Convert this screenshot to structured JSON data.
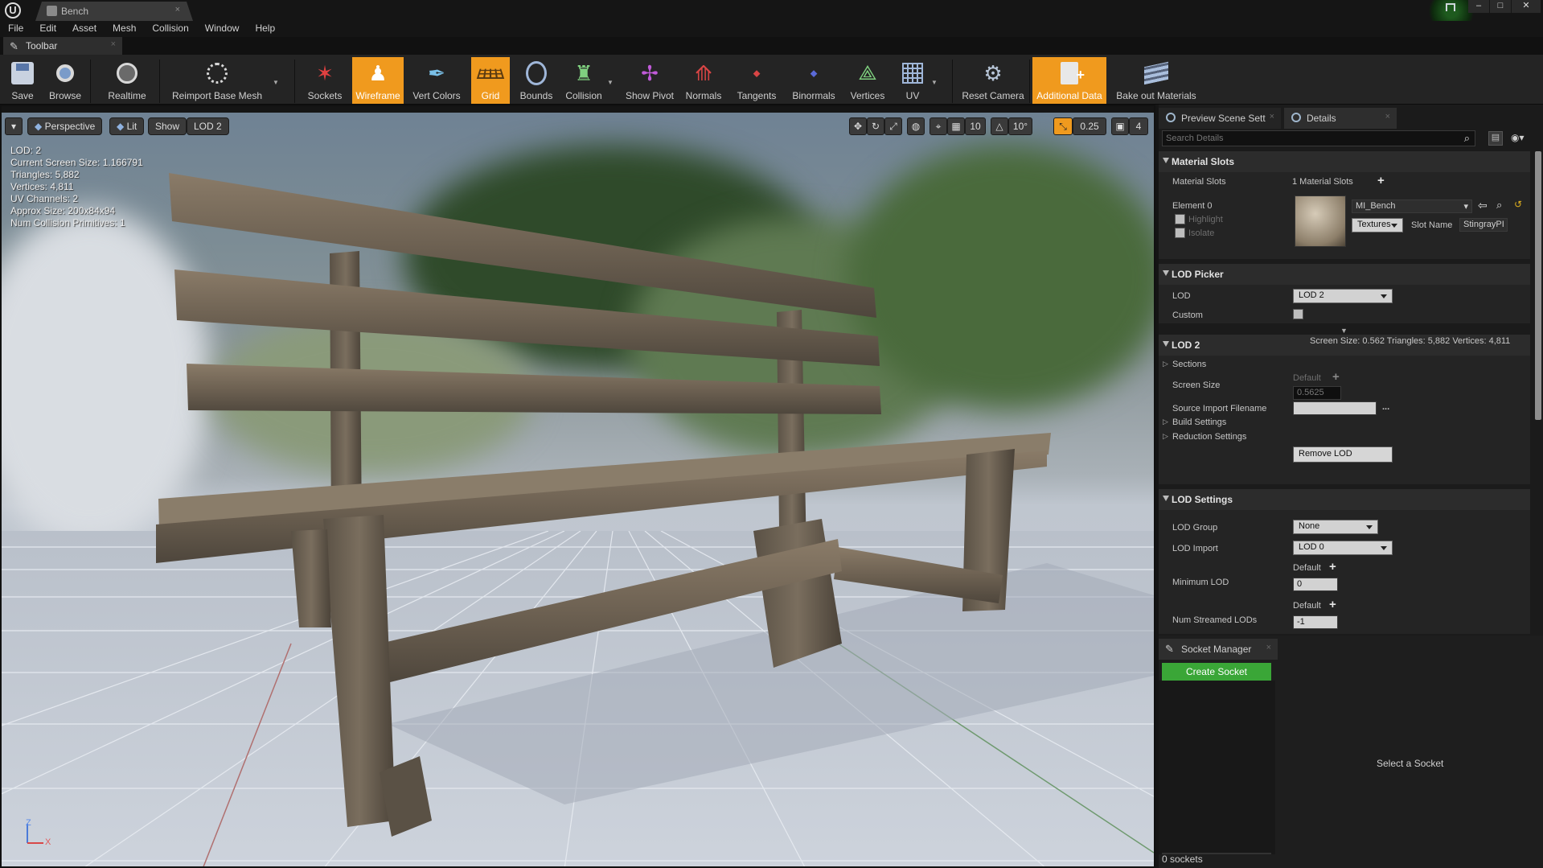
{
  "window": {
    "logo": "U",
    "tab_title": "Bench",
    "tab_close": "×",
    "minimize": "–",
    "maximize": "□",
    "close": "✕"
  },
  "menu": [
    "File",
    "Edit",
    "Asset",
    "Mesh",
    "Collision",
    "Window",
    "Help"
  ],
  "toolbar_tab": {
    "label": "Toolbar",
    "close": "×"
  },
  "toolbar": [
    {
      "label": "Save",
      "icon": "save-icon"
    },
    {
      "label": "Browse",
      "icon": "browse-icon"
    },
    {
      "label": "Realtime",
      "icon": "realtime-icon"
    },
    {
      "label": "Reimport Base Mesh",
      "icon": "reimport-icon"
    },
    {
      "label": "Sockets",
      "icon": "sockets-icon"
    },
    {
      "label": "Wireframe",
      "icon": "wireframe-icon",
      "active": true
    },
    {
      "label": "Vert Colors",
      "icon": "vert-colors-icon"
    },
    {
      "label": "Grid",
      "icon": "grid-icon",
      "active": true
    },
    {
      "label": "Bounds",
      "icon": "bounds-icon"
    },
    {
      "label": "Collision",
      "icon": "collision-icon"
    },
    {
      "label": "Show Pivot",
      "icon": "pivot-icon"
    },
    {
      "label": "Normals",
      "icon": "normals-icon"
    },
    {
      "label": "Tangents",
      "icon": "tangents-icon"
    },
    {
      "label": "Binormals",
      "icon": "binormals-icon"
    },
    {
      "label": "Vertices",
      "icon": "vertices-icon"
    },
    {
      "label": "UV",
      "icon": "uv-icon"
    },
    {
      "label": "Reset Camera",
      "icon": "camera-icon"
    },
    {
      "label": "Additional Data",
      "icon": "additional-data-icon",
      "active": true
    },
    {
      "label": "Bake out Materials",
      "icon": "bake-materials-icon"
    }
  ],
  "viewport": {
    "buttons": {
      "perspective": "Perspective",
      "lit": "Lit",
      "show": "Show",
      "lod": "LOD 2"
    },
    "grid_snap": "10",
    "rotation_snap": "10°",
    "scale_snap": "0.25",
    "camera_speed": "4",
    "stats": [
      "LOD: 2",
      "Current Screen Size: 1.166791",
      "Triangles: 5,882",
      "Vertices: 4,811",
      "UV Channels: 2",
      "Approx Size: 200x84x94",
      "Num Collision Primitives: 1"
    ],
    "axis": {
      "z": "Z",
      "x": "X"
    },
    "colors": {
      "active_orange": "#f09a1e"
    }
  },
  "panel_tabs": [
    {
      "label": "Preview Scene Sett",
      "close": "×"
    },
    {
      "label": "Details",
      "close": "×"
    }
  ],
  "search": {
    "placeholder": "Search Details"
  },
  "material_slots": {
    "header": "Material Slots",
    "label": "Material Slots",
    "count": "1 Material Slots",
    "element_label": "Element 0",
    "highlight": "Highlight",
    "isolate": "Isolate",
    "material": "MI_Bench",
    "textures": "Textures",
    "slot_name_label": "Slot Name",
    "slot_name_value": "StingrayPI"
  },
  "lod_picker": {
    "header": "LOD Picker",
    "lod_label": "LOD",
    "lod_value": "LOD 2",
    "custom_label": "Custom"
  },
  "lod2": {
    "header": "LOD 2",
    "summary": "Screen Size: 0.562   Triangles: 5,882   Vertices: 4,811",
    "sections": "Sections",
    "screen_size_label": "Screen Size",
    "screen_size_default": "Default",
    "screen_size_value": "0.5625",
    "source_import_label": "Source Import Filename",
    "source_import_value": "",
    "ellipsis": "...",
    "build_settings": "Build Settings",
    "reduction_settings": "Reduction Settings",
    "remove_lod": "Remove LOD"
  },
  "lod_settings": {
    "header": "LOD Settings",
    "group_label": "LOD Group",
    "group_value": "None",
    "import_label": "LOD Import",
    "import_value": "LOD 0",
    "min_lod_label": "Minimum LOD",
    "min_lod_default": "Default",
    "min_lod_value": "0",
    "streamed_label": "Num Streamed LODs",
    "streamed_default": "Default",
    "streamed_value": "-1"
  },
  "socket_manager": {
    "tab": "Socket Manager",
    "close": "×",
    "create": "Create Socket",
    "hint": "Select a Socket",
    "count": "0 sockets"
  }
}
